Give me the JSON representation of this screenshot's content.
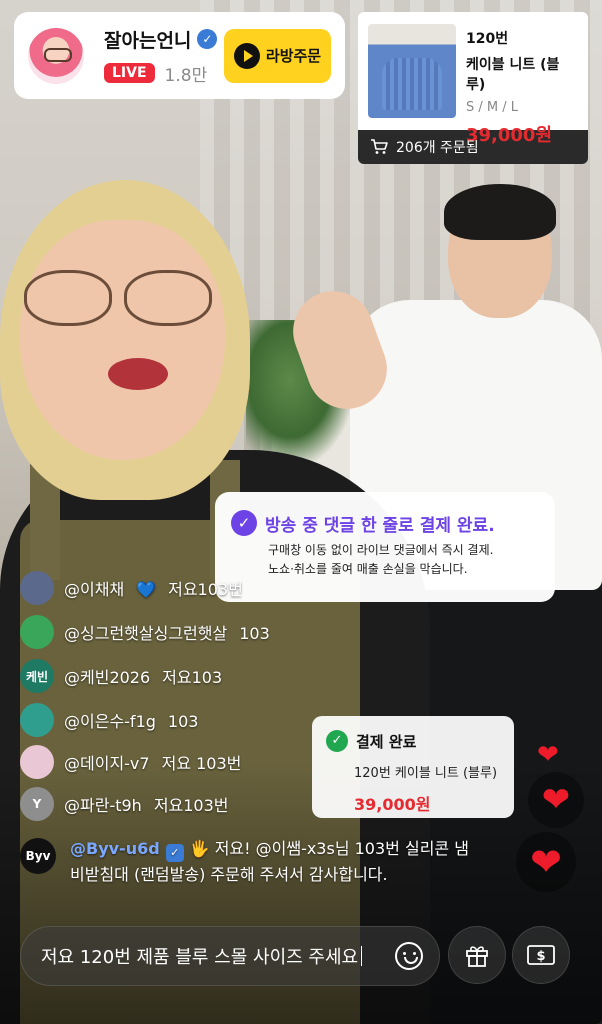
{
  "streamer": {
    "name": "잘아는언니",
    "live_label": "LIVE",
    "viewers": "1.8만",
    "order_button": "라방주문"
  },
  "product": {
    "number": "120번",
    "name": "케이블 니트 (블루)",
    "sizes": "S / M / L",
    "price": "39,000원",
    "orders": "206개 주문됨"
  },
  "info_popup": {
    "title": "방송 중 댓글 한 줄로 결제 완료.",
    "line1": "구매창 이동 없이 라이브 댓글에서 즉시 결제.",
    "line2": "노쇼·취소를 줄여 매출 손실을 막습니다."
  },
  "chat": [
    {
      "user": "@이채채",
      "text": "저요103번",
      "avatar_label": "",
      "avatar_color": "#5b6a8c",
      "heart": "💙"
    },
    {
      "user": "@싱그런햇살싱그런햇살",
      "text": "103",
      "avatar_label": "",
      "avatar_color": "#3aa65a",
      "heart": ""
    },
    {
      "user": "@케빈2026",
      "text": "저요103",
      "avatar_label": "케빈",
      "avatar_color": "#1f7a63",
      "heart": ""
    },
    {
      "user": "@이은수-f1g",
      "text": "103",
      "avatar_label": "",
      "avatar_color": "#2f9e8f",
      "heart": ""
    },
    {
      "user": "@데이지-v7",
      "text": "저요 103번",
      "avatar_label": "",
      "avatar_color": "#e9c7d4",
      "heart": ""
    },
    {
      "user": "@파란-t9h",
      "text": "저요103번",
      "avatar_label": "Y",
      "avatar_color": "#8e8e8e",
      "heart": ""
    }
  ],
  "mention": {
    "avatar_label": "Byv",
    "user": "@Byv-u6d",
    "wave": "🖐",
    "text": "저요! @이쌤-x3s님 103번 실리콘 냄비받침대 (랜덤발송) 주문해 주셔서 감사합니다."
  },
  "payment_toast": {
    "title": "결제 완료",
    "product": "120번 케이블 니트 (블루)",
    "price": "39,000원"
  },
  "comment_input": {
    "value": "저요 120번 제품 블루 스몰 사이즈 주세요"
  },
  "icons": {
    "verified": "verified-badge-icon",
    "play": "play-icon",
    "cart": "cart-icon",
    "check": "check-icon",
    "heart": "heart-icon",
    "emoji": "emoji-icon",
    "gift": "gift-icon",
    "payment": "payment-icon"
  },
  "colors": {
    "live": "#ee2b3b",
    "order_button": "#ffd21f",
    "price": "#e52a30",
    "accent_purple": "#6d43e6",
    "success_green": "#20a750"
  }
}
